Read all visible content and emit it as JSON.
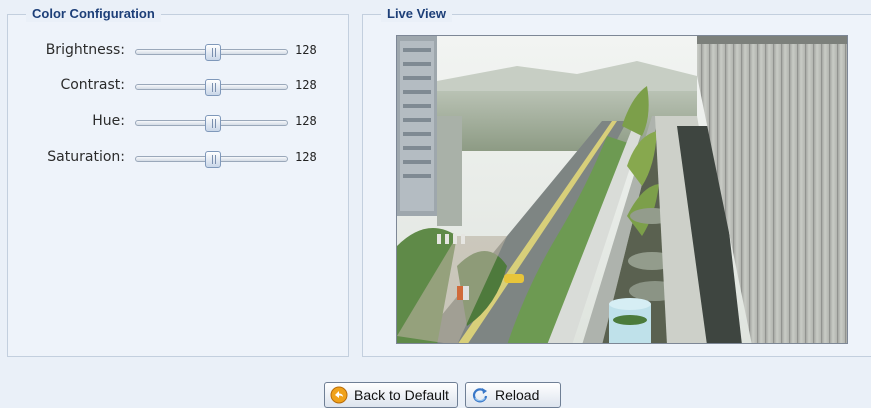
{
  "color_config": {
    "title": "Color Configuration",
    "sliders": [
      {
        "label": "Brightness:",
        "value": "128",
        "level": 0.5
      },
      {
        "label": "Contrast:",
        "value": "128",
        "level": 0.5
      },
      {
        "label": "Hue:",
        "value": "128",
        "level": 0.5
      },
      {
        "label": "Saturation:",
        "value": "128",
        "level": 0.5
      }
    ]
  },
  "live_view": {
    "title": "Live View",
    "image_description_icon": "camera-feed-street-balcony"
  },
  "buttons": {
    "back_to_default": "Back to Default",
    "reload": "Reload"
  },
  "colors": {
    "legend_text": "#1d3f78",
    "panel_border": "#c3cfde",
    "background": "#eaf0f8"
  }
}
